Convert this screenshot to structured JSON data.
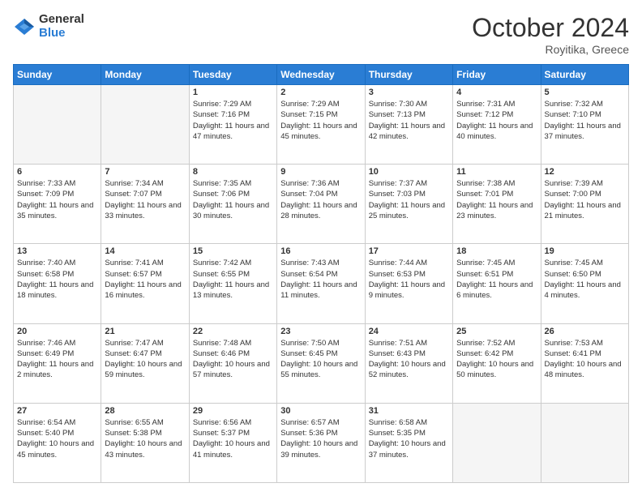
{
  "header": {
    "logo_general": "General",
    "logo_blue": "Blue",
    "month_title": "October 2024",
    "location": "Royitika, Greece"
  },
  "days_of_week": [
    "Sunday",
    "Monday",
    "Tuesday",
    "Wednesday",
    "Thursday",
    "Friday",
    "Saturday"
  ],
  "weeks": [
    [
      {
        "day": "",
        "info": ""
      },
      {
        "day": "",
        "info": ""
      },
      {
        "day": "1",
        "info": "Sunrise: 7:29 AM\nSunset: 7:16 PM\nDaylight: 11 hours and 47 minutes."
      },
      {
        "day": "2",
        "info": "Sunrise: 7:29 AM\nSunset: 7:15 PM\nDaylight: 11 hours and 45 minutes."
      },
      {
        "day": "3",
        "info": "Sunrise: 7:30 AM\nSunset: 7:13 PM\nDaylight: 11 hours and 42 minutes."
      },
      {
        "day": "4",
        "info": "Sunrise: 7:31 AM\nSunset: 7:12 PM\nDaylight: 11 hours and 40 minutes."
      },
      {
        "day": "5",
        "info": "Sunrise: 7:32 AM\nSunset: 7:10 PM\nDaylight: 11 hours and 37 minutes."
      }
    ],
    [
      {
        "day": "6",
        "info": "Sunrise: 7:33 AM\nSunset: 7:09 PM\nDaylight: 11 hours and 35 minutes."
      },
      {
        "day": "7",
        "info": "Sunrise: 7:34 AM\nSunset: 7:07 PM\nDaylight: 11 hours and 33 minutes."
      },
      {
        "day": "8",
        "info": "Sunrise: 7:35 AM\nSunset: 7:06 PM\nDaylight: 11 hours and 30 minutes."
      },
      {
        "day": "9",
        "info": "Sunrise: 7:36 AM\nSunset: 7:04 PM\nDaylight: 11 hours and 28 minutes."
      },
      {
        "day": "10",
        "info": "Sunrise: 7:37 AM\nSunset: 7:03 PM\nDaylight: 11 hours and 25 minutes."
      },
      {
        "day": "11",
        "info": "Sunrise: 7:38 AM\nSunset: 7:01 PM\nDaylight: 11 hours and 23 minutes."
      },
      {
        "day": "12",
        "info": "Sunrise: 7:39 AM\nSunset: 7:00 PM\nDaylight: 11 hours and 21 minutes."
      }
    ],
    [
      {
        "day": "13",
        "info": "Sunrise: 7:40 AM\nSunset: 6:58 PM\nDaylight: 11 hours and 18 minutes."
      },
      {
        "day": "14",
        "info": "Sunrise: 7:41 AM\nSunset: 6:57 PM\nDaylight: 11 hours and 16 minutes."
      },
      {
        "day": "15",
        "info": "Sunrise: 7:42 AM\nSunset: 6:55 PM\nDaylight: 11 hours and 13 minutes."
      },
      {
        "day": "16",
        "info": "Sunrise: 7:43 AM\nSunset: 6:54 PM\nDaylight: 11 hours and 11 minutes."
      },
      {
        "day": "17",
        "info": "Sunrise: 7:44 AM\nSunset: 6:53 PM\nDaylight: 11 hours and 9 minutes."
      },
      {
        "day": "18",
        "info": "Sunrise: 7:45 AM\nSunset: 6:51 PM\nDaylight: 11 hours and 6 minutes."
      },
      {
        "day": "19",
        "info": "Sunrise: 7:45 AM\nSunset: 6:50 PM\nDaylight: 11 hours and 4 minutes."
      }
    ],
    [
      {
        "day": "20",
        "info": "Sunrise: 7:46 AM\nSunset: 6:49 PM\nDaylight: 11 hours and 2 minutes."
      },
      {
        "day": "21",
        "info": "Sunrise: 7:47 AM\nSunset: 6:47 PM\nDaylight: 10 hours and 59 minutes."
      },
      {
        "day": "22",
        "info": "Sunrise: 7:48 AM\nSunset: 6:46 PM\nDaylight: 10 hours and 57 minutes."
      },
      {
        "day": "23",
        "info": "Sunrise: 7:50 AM\nSunset: 6:45 PM\nDaylight: 10 hours and 55 minutes."
      },
      {
        "day": "24",
        "info": "Sunrise: 7:51 AM\nSunset: 6:43 PM\nDaylight: 10 hours and 52 minutes."
      },
      {
        "day": "25",
        "info": "Sunrise: 7:52 AM\nSunset: 6:42 PM\nDaylight: 10 hours and 50 minutes."
      },
      {
        "day": "26",
        "info": "Sunrise: 7:53 AM\nSunset: 6:41 PM\nDaylight: 10 hours and 48 minutes."
      }
    ],
    [
      {
        "day": "27",
        "info": "Sunrise: 6:54 AM\nSunset: 5:40 PM\nDaylight: 10 hours and 45 minutes."
      },
      {
        "day": "28",
        "info": "Sunrise: 6:55 AM\nSunset: 5:38 PM\nDaylight: 10 hours and 43 minutes."
      },
      {
        "day": "29",
        "info": "Sunrise: 6:56 AM\nSunset: 5:37 PM\nDaylight: 10 hours and 41 minutes."
      },
      {
        "day": "30",
        "info": "Sunrise: 6:57 AM\nSunset: 5:36 PM\nDaylight: 10 hours and 39 minutes."
      },
      {
        "day": "31",
        "info": "Sunrise: 6:58 AM\nSunset: 5:35 PM\nDaylight: 10 hours and 37 minutes."
      },
      {
        "day": "",
        "info": ""
      },
      {
        "day": "",
        "info": ""
      }
    ]
  ]
}
